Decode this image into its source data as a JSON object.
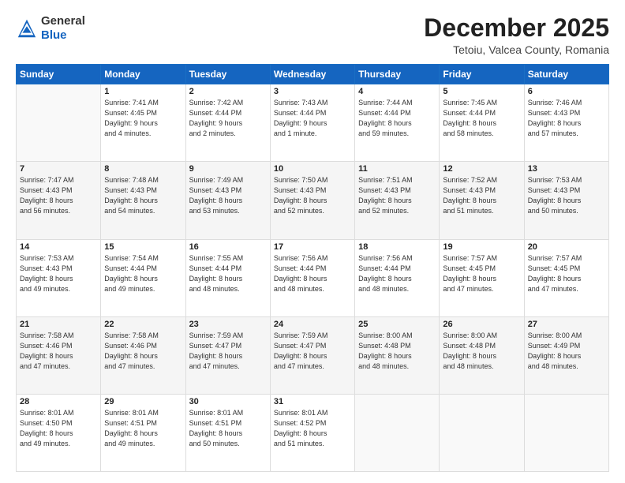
{
  "header": {
    "logo_general": "General",
    "logo_blue": "Blue",
    "title": "December 2025",
    "location": "Tetoiu, Valcea County, Romania"
  },
  "days_of_week": [
    "Sunday",
    "Monday",
    "Tuesday",
    "Wednesday",
    "Thursday",
    "Friday",
    "Saturday"
  ],
  "weeks": [
    [
      {
        "day": "",
        "info": ""
      },
      {
        "day": "1",
        "info": "Sunrise: 7:41 AM\nSunset: 4:45 PM\nDaylight: 9 hours\nand 4 minutes."
      },
      {
        "day": "2",
        "info": "Sunrise: 7:42 AM\nSunset: 4:44 PM\nDaylight: 9 hours\nand 2 minutes."
      },
      {
        "day": "3",
        "info": "Sunrise: 7:43 AM\nSunset: 4:44 PM\nDaylight: 9 hours\nand 1 minute."
      },
      {
        "day": "4",
        "info": "Sunrise: 7:44 AM\nSunset: 4:44 PM\nDaylight: 8 hours\nand 59 minutes."
      },
      {
        "day": "5",
        "info": "Sunrise: 7:45 AM\nSunset: 4:44 PM\nDaylight: 8 hours\nand 58 minutes."
      },
      {
        "day": "6",
        "info": "Sunrise: 7:46 AM\nSunset: 4:43 PM\nDaylight: 8 hours\nand 57 minutes."
      }
    ],
    [
      {
        "day": "7",
        "info": "Sunrise: 7:47 AM\nSunset: 4:43 PM\nDaylight: 8 hours\nand 56 minutes."
      },
      {
        "day": "8",
        "info": "Sunrise: 7:48 AM\nSunset: 4:43 PM\nDaylight: 8 hours\nand 54 minutes."
      },
      {
        "day": "9",
        "info": "Sunrise: 7:49 AM\nSunset: 4:43 PM\nDaylight: 8 hours\nand 53 minutes."
      },
      {
        "day": "10",
        "info": "Sunrise: 7:50 AM\nSunset: 4:43 PM\nDaylight: 8 hours\nand 52 minutes."
      },
      {
        "day": "11",
        "info": "Sunrise: 7:51 AM\nSunset: 4:43 PM\nDaylight: 8 hours\nand 52 minutes."
      },
      {
        "day": "12",
        "info": "Sunrise: 7:52 AM\nSunset: 4:43 PM\nDaylight: 8 hours\nand 51 minutes."
      },
      {
        "day": "13",
        "info": "Sunrise: 7:53 AM\nSunset: 4:43 PM\nDaylight: 8 hours\nand 50 minutes."
      }
    ],
    [
      {
        "day": "14",
        "info": "Sunrise: 7:53 AM\nSunset: 4:43 PM\nDaylight: 8 hours\nand 49 minutes."
      },
      {
        "day": "15",
        "info": "Sunrise: 7:54 AM\nSunset: 4:44 PM\nDaylight: 8 hours\nand 49 minutes."
      },
      {
        "day": "16",
        "info": "Sunrise: 7:55 AM\nSunset: 4:44 PM\nDaylight: 8 hours\nand 48 minutes."
      },
      {
        "day": "17",
        "info": "Sunrise: 7:56 AM\nSunset: 4:44 PM\nDaylight: 8 hours\nand 48 minutes."
      },
      {
        "day": "18",
        "info": "Sunrise: 7:56 AM\nSunset: 4:44 PM\nDaylight: 8 hours\nand 48 minutes."
      },
      {
        "day": "19",
        "info": "Sunrise: 7:57 AM\nSunset: 4:45 PM\nDaylight: 8 hours\nand 47 minutes."
      },
      {
        "day": "20",
        "info": "Sunrise: 7:57 AM\nSunset: 4:45 PM\nDaylight: 8 hours\nand 47 minutes."
      }
    ],
    [
      {
        "day": "21",
        "info": "Sunrise: 7:58 AM\nSunset: 4:46 PM\nDaylight: 8 hours\nand 47 minutes."
      },
      {
        "day": "22",
        "info": "Sunrise: 7:58 AM\nSunset: 4:46 PM\nDaylight: 8 hours\nand 47 minutes."
      },
      {
        "day": "23",
        "info": "Sunrise: 7:59 AM\nSunset: 4:47 PM\nDaylight: 8 hours\nand 47 minutes."
      },
      {
        "day": "24",
        "info": "Sunrise: 7:59 AM\nSunset: 4:47 PM\nDaylight: 8 hours\nand 47 minutes."
      },
      {
        "day": "25",
        "info": "Sunrise: 8:00 AM\nSunset: 4:48 PM\nDaylight: 8 hours\nand 48 minutes."
      },
      {
        "day": "26",
        "info": "Sunrise: 8:00 AM\nSunset: 4:48 PM\nDaylight: 8 hours\nand 48 minutes."
      },
      {
        "day": "27",
        "info": "Sunrise: 8:00 AM\nSunset: 4:49 PM\nDaylight: 8 hours\nand 48 minutes."
      }
    ],
    [
      {
        "day": "28",
        "info": "Sunrise: 8:01 AM\nSunset: 4:50 PM\nDaylight: 8 hours\nand 49 minutes."
      },
      {
        "day": "29",
        "info": "Sunrise: 8:01 AM\nSunset: 4:51 PM\nDaylight: 8 hours\nand 49 minutes."
      },
      {
        "day": "30",
        "info": "Sunrise: 8:01 AM\nSunset: 4:51 PM\nDaylight: 8 hours\nand 50 minutes."
      },
      {
        "day": "31",
        "info": "Sunrise: 8:01 AM\nSunset: 4:52 PM\nDaylight: 8 hours\nand 51 minutes."
      },
      {
        "day": "",
        "info": ""
      },
      {
        "day": "",
        "info": ""
      },
      {
        "day": "",
        "info": ""
      }
    ]
  ]
}
